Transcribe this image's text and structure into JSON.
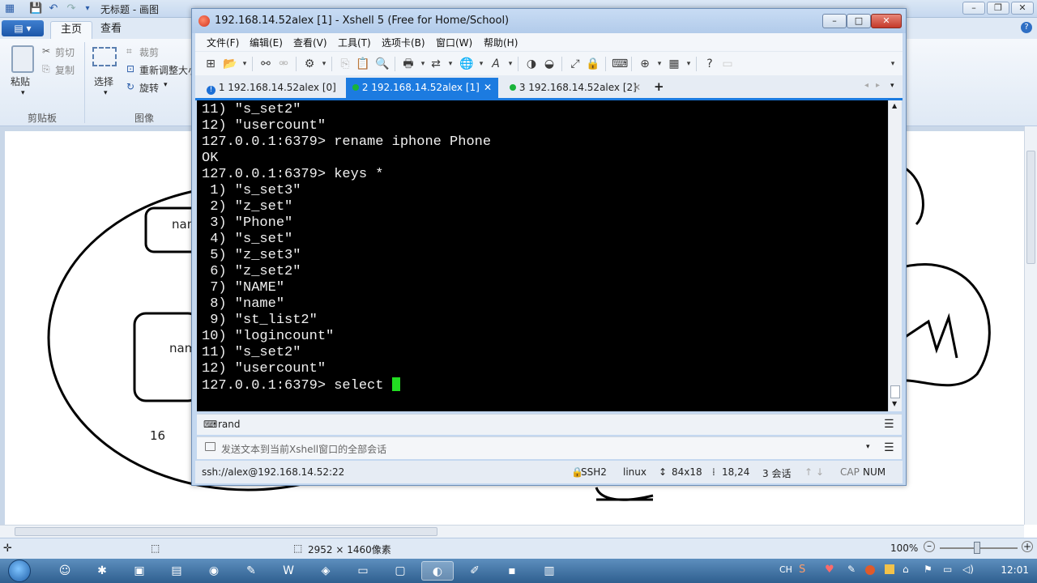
{
  "paint": {
    "title": "无标题 - 画图",
    "tabs": [
      {
        "label": "主页"
      },
      {
        "label": "查看"
      }
    ],
    "clipboard": {
      "paste": "粘贴",
      "cut": "剪切",
      "copy": "复制",
      "group": "剪贴板"
    },
    "image": {
      "select": "选择",
      "crop": "裁剪",
      "resize": "重新调整大小",
      "rotate": "旋转",
      "group": "图像"
    },
    "canvas_labels": [
      {
        "text": "nam"
      },
      {
        "text": "nam"
      },
      {
        "text": "16"
      }
    ],
    "status": {
      "dimensions": "2952 × 1460像素",
      "zoom": "100%"
    }
  },
  "xshell": {
    "title": "192.168.14.52alex [1] - Xshell 5 (Free for Home/School)",
    "menu": [
      {
        "label": "文件(F)"
      },
      {
        "label": "编辑(E)"
      },
      {
        "label": "查看(V)"
      },
      {
        "label": "工具(T)"
      },
      {
        "label": "选项卡(B)"
      },
      {
        "label": "窗口(W)"
      },
      {
        "label": "帮助(H)"
      }
    ],
    "tabs": [
      {
        "label": "1 192.168.14.52alex [0]",
        "status_color": "#1c6fd6"
      },
      {
        "label": "2 192.168.14.52alex [1]",
        "status_color": "#19b33a"
      },
      {
        "label": "3 192.168.14.52alex [2]",
        "status_color": "#19b33a"
      }
    ],
    "add_tab": "+",
    "terminal": {
      "lines": [
        "11) \"s_set2\"",
        "12) \"usercount\"",
        "127.0.0.1:6379> rename iphone Phone",
        "OK",
        "127.0.0.1:6379> keys *",
        " 1) \"s_set3\"",
        " 2) \"z_set\"",
        " 3) \"Phone\"",
        " 4) \"s_set\"",
        " 5) \"z_set3\"",
        " 6) \"z_set2\"",
        " 7) \"NAME\"",
        " 8) \"name\"",
        " 9) \"st_list2\"",
        "10) \"logincount\"",
        "11) \"s_set2\"",
        "12) \"usercount\""
      ],
      "prompt": "127.0.0.1:6379> select ",
      "cursor_color": "#22dd22"
    },
    "compose_text": "rand",
    "send_placeholder": "发送文本到当前Xshell窗口的全部会话",
    "status": {
      "connection": "ssh://alex@192.168.14.52:22",
      "protocol": "SSH2",
      "term": "linux",
      "size": "84x18",
      "pos": "18,24",
      "sessions": "3 会话",
      "cap": "CAP",
      "num": "NUM"
    }
  },
  "taskbar": {
    "ime": "CH",
    "clock": "12:01"
  }
}
